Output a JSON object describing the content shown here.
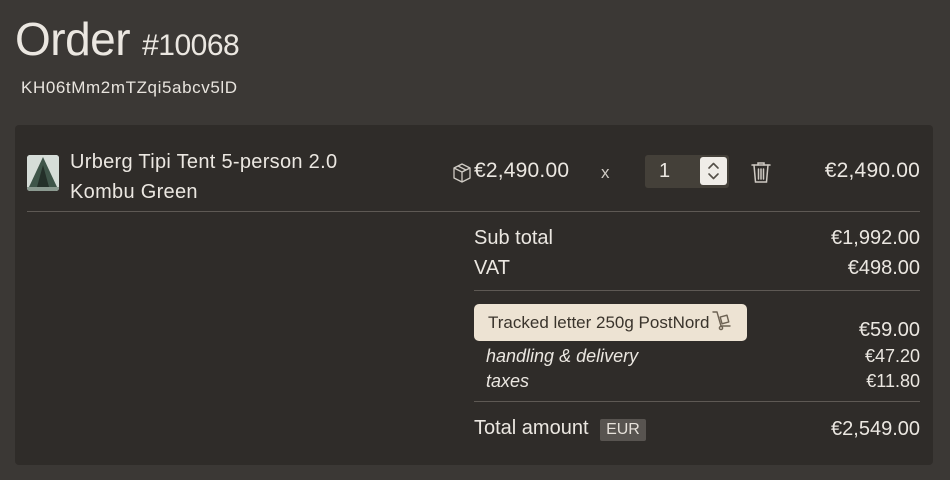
{
  "order": {
    "title": "Order",
    "number": "#10068",
    "id": "KH06tMm2mTZqi5abcv5lD"
  },
  "line_item": {
    "name_line1": "Urberg Tipi Tent 5-person 2.0",
    "name_line2": "Kombu Green",
    "unit_price": "€2,490.00",
    "times": "x",
    "quantity": "1",
    "line_total": "€2,490.00",
    "icons": [
      "package-icon",
      "stepper-icon",
      "trash-icon"
    ]
  },
  "summary": {
    "subtotal_label": "Sub total",
    "subtotal_value": "€1,992.00",
    "vat_label": "VAT",
    "vat_value": "€498.00",
    "shipping_method": "Tracked letter 250g PostNord",
    "shipping_value": "€59.00",
    "handling_label": "handling & delivery",
    "handling_value": "€47.20",
    "taxes_label": "taxes",
    "taxes_value": "€11.80",
    "total_label": "Total amount",
    "currency": "EUR",
    "total_value": "€2,549.00"
  },
  "colors": {
    "background": "#3b3835",
    "panel": "#2f2c29",
    "shipping_badge": "#ede3d3",
    "text": "#ebe7e1"
  }
}
